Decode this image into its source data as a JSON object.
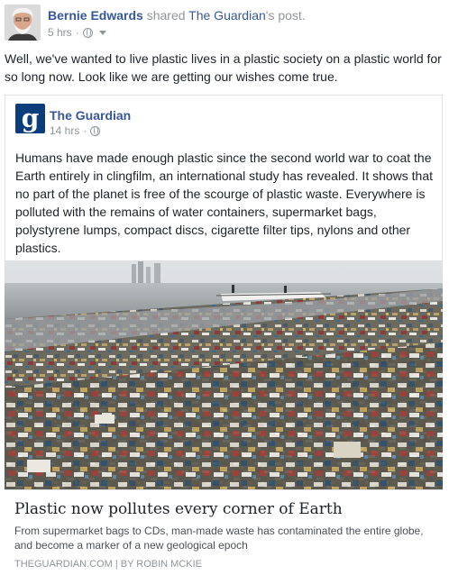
{
  "post": {
    "author_name": "Bernie Edwards",
    "shared_text": " shared ",
    "shared_page": "The Guardian",
    "shared_suffix": "'s post.",
    "time": "5 hrs",
    "separator": "·",
    "privacy_icon": "globe-icon",
    "status": "Well, we've wanted to live plastic lives in a plastic society on a plastic world for so long now. Look like we are getting our wishes come true."
  },
  "shared_post": {
    "page_name": "The Guardian",
    "logo_letter": "g",
    "time": "14 hrs",
    "separator": "·",
    "privacy_icon": "globe-icon",
    "text": "Humans have made enough plastic since the second world war to coat the Earth entirely in clingfilm, an international study has revealed. It shows that no part of the planet is free of the scourge of plastic waste. Everywhere is polluted with the remains of water containers, supermarket bags, polystyrene lumps, compact discs, cigarette filter tips, nylons and other plastics."
  },
  "link": {
    "title": "Plastic now pollutes every corner of Earth",
    "description": "From supermarket bags to CDs, man-made waste has contaminated the entire globe, and become a marker of a new geological epoch",
    "source": "THEGUARDIAN.COM | BY ROBIN MCKIE"
  },
  "colors": {
    "link_blue": "#365899",
    "meta_gray": "#90949c",
    "guardian_blue": "#0a3d7c",
    "border": "#dddfe2"
  }
}
